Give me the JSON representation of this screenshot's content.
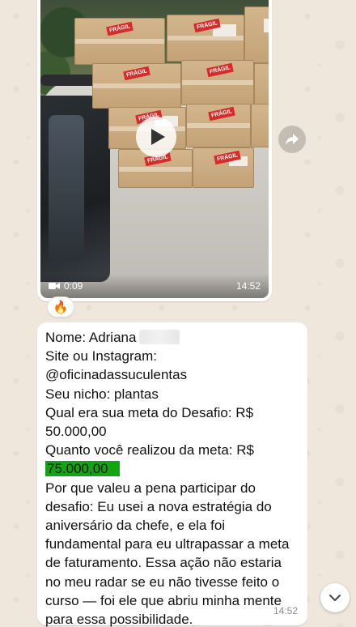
{
  "video_message": {
    "duration": "0:09",
    "time": "14:52",
    "box_tag": "FRÁGIL",
    "icons": {
      "play": "play-icon",
      "camera": "video-camera-icon",
      "forward": "forward-icon"
    }
  },
  "reaction": {
    "emoji": "🔥"
  },
  "text_message": {
    "lines": {
      "name_label": "Nome: Adriana",
      "site_label": "Site ou Instagram:",
      "handle": "@oficinadassuculentas",
      "niche": "Seu nicho: plantas",
      "goal_q": "Qual era sua meta do Desafio: R$",
      "goal_value": "50.000,00",
      "achieved_q": "Quanto você realizou da meta: R$",
      "achieved_value": "75.000,00",
      "why_1": "Por que valeu a pena participar do",
      "why_2": "desafio: Eu usei a nova estratégia do",
      "why_3": "aniversário da chefe, e ela foi",
      "why_4": "fundamental para eu ultrapassar a meta",
      "why_5": "de faturamento. Essa ação não estaria",
      "why_6": "no meu radar se eu não tivesse feito o",
      "why_7": "curso — foi ele que abriu minha mente",
      "why_8": "para essa possibilidade."
    },
    "time": "14:52"
  },
  "scroll_button": {
    "icon": "chevron-down-icon"
  },
  "colors": {
    "wallpaper": "#efe7dc",
    "bubble": "#ffffff",
    "highlight": "#15a315",
    "timestamp": "#8c8c8c"
  }
}
